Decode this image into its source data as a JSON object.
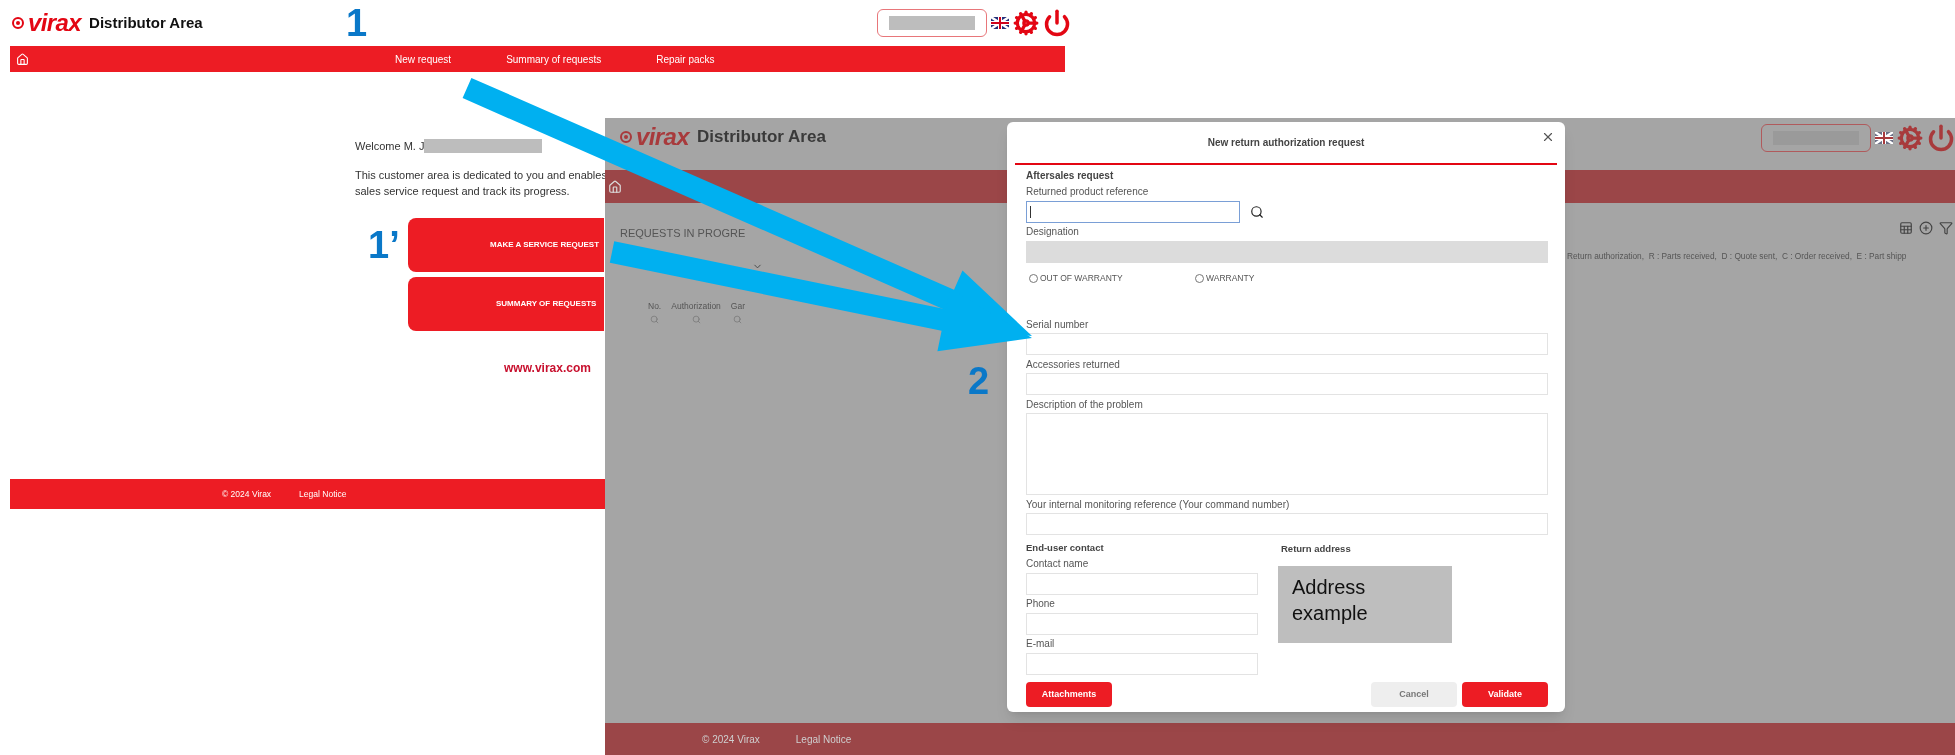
{
  "left_screen": {
    "logo": "virax",
    "title": "Distributor Area",
    "nav": [
      "New request",
      "Summary of requests",
      "Repair packs"
    ],
    "welcome": "Welcome M. J",
    "intro_lines": [
      "This customer area is dedicated to you and enables",
      "sales service request and track its progress."
    ],
    "buttons": [
      "MAKE A SERVICE REQUEST",
      "SUMMARY OF REQUESTS"
    ],
    "website": "www.virax.com",
    "footer": [
      "© 2024 Virax",
      "Legal Notice"
    ]
  },
  "right_screen": {
    "logo": "virax",
    "title": "Distributor Area",
    "section": "REQUESTS IN PROGRE",
    "columns": [
      "No.",
      "Authorization",
      "Gar"
    ],
    "legend": "Return authorization,  R : Parts received,  D : Quote sent,  C : Order received,  E : Part shipp",
    "footer": [
      "© 2024 Virax",
      "Legal Notice"
    ]
  },
  "dialog": {
    "title": "New return authorization request",
    "section": "Aftersales request",
    "product_fields": [
      {
        "kind": "search",
        "label": "Returned product reference",
        "focused": true,
        "disabled": false
      },
      {
        "kind": "text",
        "label": "Designation",
        "focused": false,
        "disabled": true
      }
    ],
    "radios": [
      {
        "label": "OUT OF WARRANTY",
        "selected": false
      },
      {
        "label": "WARRANTY",
        "selected": false
      }
    ],
    "detail_fields": [
      {
        "kind": "text",
        "label": "Serial number"
      },
      {
        "kind": "text",
        "label": "Accessories returned"
      },
      {
        "kind": "textarea",
        "label": "Description of the problem"
      },
      {
        "kind": "text",
        "label": "Your internal monitoring reference (Your command number)"
      }
    ],
    "contact": {
      "heading": "End-user contact",
      "fields": [
        "Contact name",
        "Phone",
        "E-mail"
      ]
    },
    "return_address": {
      "heading": "Return address",
      "block": "Address example"
    },
    "buttons": [
      {
        "label": "Attachments",
        "kind": "primary"
      },
      {
        "label": "Cancel",
        "kind": "secondary"
      },
      {
        "label": "Validate",
        "kind": "primary"
      }
    ]
  },
  "annotations": [
    {
      "label": "1"
    },
    {
      "label": "1’"
    },
    {
      "label": "2"
    }
  ]
}
